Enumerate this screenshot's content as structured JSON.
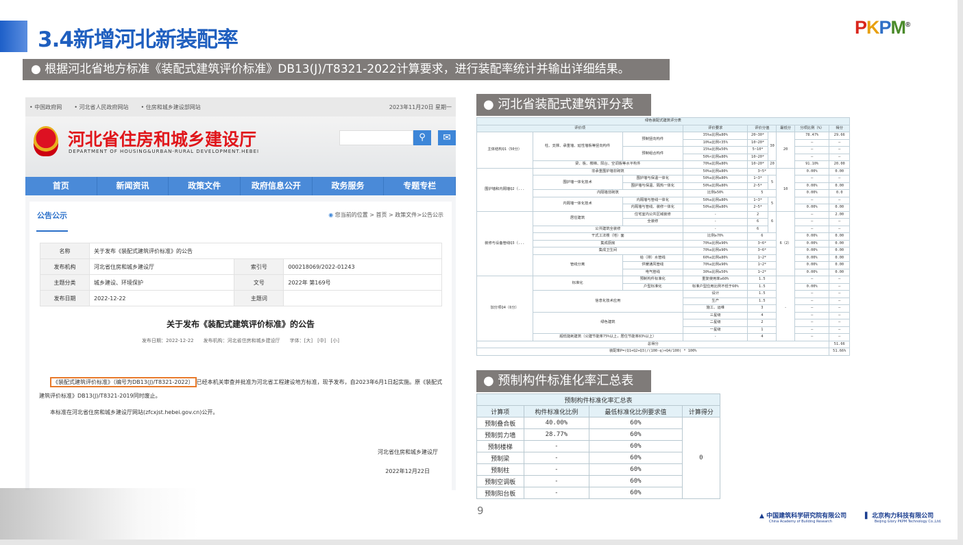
{
  "slide": {
    "title": "3.4新增河北新装配率",
    "banner": "● 根据河北省地方标准《装配式建筑评价标准》DB13(J)/T8321-2022计算要求，进行装配率统计并输出详细结果。",
    "logo": "PKPM",
    "logo_mark": "®",
    "page_number": "9",
    "label_score": "● 河北省装配式建筑评分表",
    "label_std": "● 预制构件标准化率汇总表",
    "org1": "中国建筑科学研究院有限公司",
    "org1_en": "China Academy of Building Research",
    "org2": "北京构力科技有限公司",
    "org2_en": "Beijing Glory PKPM Technology Co.,Ltd."
  },
  "site": {
    "top_links": [
      "中国政府网",
      "河北省人民政府网站",
      "住房和城乡建设部网站"
    ],
    "date": "2023年11月20日 星期一",
    "name": "河北省住房和城乡建设厅",
    "name_en": "DEPARTMENT OF HOUSING&URBAN-RURAL DEVELOPMENT.HEBEI",
    "search_icon": "⚲",
    "mail_icon": "✉",
    "nav": [
      "首页",
      "新闻资讯",
      "政策文件",
      "政府信息公开",
      "政务服务",
      "专题专栏"
    ],
    "tab": "公告公示",
    "breadcrumb": "您当前的位置 > 首页 > 政策文件>公告公示",
    "info": {
      "k_name": "名称",
      "v_name": "关于发布《装配式建筑评价标准》的公告",
      "k_org": "发布机构",
      "v_org": "河北省住房和城乡建设厅",
      "k_index": "索引号",
      "v_index": "000218069/2022-01243",
      "k_topic": "主题分类",
      "v_topic": "城乡建设、环境保护",
      "k_docno": "文号",
      "v_docno": "2022年 第169号",
      "k_date": "发布日期",
      "v_date": "2022-12-22",
      "k_kw": "主题词",
      "v_kw": ""
    },
    "article_title": "关于发布《装配式建筑评价标准》的公告",
    "article_meta": "发布日期：2022-12-22　　发布机构：河北省住房和城乡建设厅　　字体：[大]　[中]　[小]",
    "p1_highlight": "《装配式建筑评价标准》（编号为DB13(J)/T8321-2022）",
    "p1_rest": "已经本机关审查并批准为河北省工程建设地方标准，现予发布，自2023年6月1日起实施。原《装配式建筑评价标准》DB13(J)/T8321-2019同时废止。",
    "p2": "本标准在河北省住房和城乡建设厅网站(zfcxjst.hebei.gov.cn)公开。",
    "signature": "河北省住房和城乡建设厅",
    "sign_date": "2022年12月22日"
  },
  "score_table": {
    "title": "绿色装配式建筑评分表",
    "headers": [
      "评价项",
      "评价要求",
      "评价分值",
      "最低分",
      "分项比例（%）",
      "得分"
    ],
    "rows": [
      [
        "主体结构Q1（50分）",
        "柱、支撑、承重墙、延性墙板等竖向构件",
        "预制竖向构件",
        "35%≤比例≤80%",
        "20~30*",
        "30",
        "20",
        "78.47%",
        "29.66"
      ],
      [
        "10%≤比例<35%",
        "10~20*",
        "—",
        "—"
      ],
      [
        "预制组合构件",
        "15%≤比例≤50%",
        "5~10*",
        "—",
        "—"
      ],
      [
        "50%<比例≤80%",
        "10~20*",
        "—",
        "—"
      ],
      [
        "梁、板、楼梯、阳台、空调板等水平构件",
        "70%≤比例≤80%",
        "10~20*",
        "20",
        "91.10%",
        "20.00"
      ],
      [
        "围护墙和内隔墙Q2（...",
        "非承重围护墙非砌筑",
        "50%≤比例≤80%",
        "3~5*",
        "10",
        "0.00%",
        "0.00"
      ],
      [
        "围护墙一体化技术",
        "围护墙与保温一体化",
        "50%≤比例≤80%",
        "1~3*",
        "5",
        "—",
        "—"
      ],
      [
        "围护墙与保温、隔热一体化",
        "50%≤比例≤80%",
        "2~5*",
        "0.00%",
        "0.00"
      ],
      [
        "内隔墙非砌筑",
        "比例≥50%",
        "5",
        "0.00%",
        "0.0"
      ],
      [
        "内隔墙一体化技术",
        "内隔墙与管线一体化",
        "50%≤比例≤80%",
        "1~3*",
        "5",
        "—",
        "—"
      ],
      [
        "内隔墙与管线、装修一体化",
        "50%≤比例≤80%",
        "2~5*",
        "0.00%",
        "0.00"
      ],
      [
        "装修与设备管线Q3（...",
        "居住建筑",
        "住宅室内公共区域装修",
        "-",
        "2",
        "6",
        "6（2）",
        "—",
        "2.00"
      ],
      [
        "全装修",
        "-",
        "6",
        "—",
        "—"
      ],
      [
        "公共建筑全装修",
        "-",
        "6",
        "—",
        "—"
      ],
      [
        "干式工法楼（地）面",
        "比例≥70%",
        "6",
        "0.00%",
        "0.00"
      ],
      [
        "集成厨房",
        "70%≤比例≤90%",
        "3~6*",
        "0.00%",
        "0.00"
      ],
      [
        "集成卫生间",
        "70%≤比例≤90%",
        "3~6*",
        "0.00%",
        "0.00"
      ],
      [
        "管线分离",
        "给（排）水管线",
        "60%≤比例≤80%",
        "1~2*",
        "0.00%",
        "0.00"
      ],
      [
        "供暖通风管线",
        "70%≤比例≤90%",
        "1~2*",
        "0.00%",
        "0.00"
      ],
      [
        "电气管线",
        "30%≤比例≤50%",
        "1~2*",
        "0.00%",
        "0.00"
      ],
      [
        "加分项Q4（6分）",
        "标准化",
        "预制构件标准化",
        "重复使用率≥60%",
        "1.5",
        "-",
        "—",
        "—"
      ],
      [
        "户型标准化",
        "标准户型应用比例不低于60%",
        "1.5",
        "0.00%",
        "—"
      ],
      [
        "信息化技术应用",
        "设计",
        "1.5",
        "—",
        "—"
      ],
      [
        "生产",
        "1.5",
        "—",
        "—"
      ],
      [
        "施工、运维",
        "3",
        "—",
        "—"
      ],
      [
        "绿色建筑",
        "三星级",
        "4",
        "—",
        "—"
      ],
      [
        "二星级",
        "2",
        "—",
        "—"
      ],
      [
        "一星级",
        "1",
        "—",
        "—"
      ],
      [
        "超低能耗建筑（公建节能率75%以上，居住节能率83%以上）",
        "-",
        "4",
        "—",
        "—"
      ],
      [
        "总得分",
        "51.66"
      ],
      [
        "装配率P=(Q1+Q2+Q3)/(100-q)+Q4/100) * 100%",
        "51.66%"
      ]
    ]
  },
  "std_table": {
    "title": "预制构件标准化率汇总表",
    "headers": [
      "计算项",
      "构件标准化比例",
      "最低标准化比例要求值",
      "计算得分"
    ],
    "score": "0",
    "rows": [
      [
        "预制叠合板",
        "40.00%",
        "60%"
      ],
      [
        "预制剪力墙",
        "28.77%",
        "60%"
      ],
      [
        "预制楼梯",
        "-",
        "60%"
      ],
      [
        "预制梁",
        "-",
        "60%"
      ],
      [
        "预制柱",
        "-",
        "60%"
      ],
      [
        "预制空调板",
        "-",
        "60%"
      ],
      [
        "预制阳台板",
        "-",
        "60%"
      ]
    ]
  }
}
